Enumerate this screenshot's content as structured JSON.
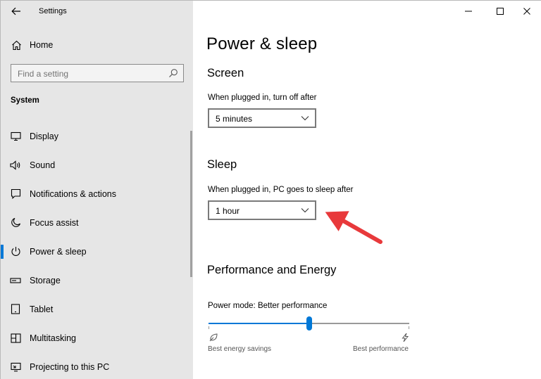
{
  "app": {
    "title": "Settings"
  },
  "sidebar": {
    "home_label": "Home",
    "search_placeholder": "Find a setting",
    "section_label": "System",
    "items": [
      {
        "label": "Display",
        "icon": "monitor-icon"
      },
      {
        "label": "Sound",
        "icon": "speaker-icon"
      },
      {
        "label": "Notifications & actions",
        "icon": "notification-icon"
      },
      {
        "label": "Focus assist",
        "icon": "moon-icon"
      },
      {
        "label": "Power & sleep",
        "icon": "power-icon",
        "selected": true
      },
      {
        "label": "Storage",
        "icon": "storage-icon"
      },
      {
        "label": "Tablet",
        "icon": "tablet-icon"
      },
      {
        "label": "Multitasking",
        "icon": "multitasking-icon"
      },
      {
        "label": "Projecting to this PC",
        "icon": "projector-icon"
      }
    ]
  },
  "main": {
    "title": "Power & sleep",
    "screen": {
      "heading": "Screen",
      "label": "When plugged in, turn off after",
      "value": "5 minutes"
    },
    "sleep": {
      "heading": "Sleep",
      "label": "When plugged in, PC goes to sleep after",
      "value": "1 hour"
    },
    "performance": {
      "heading": "Performance and Energy",
      "label": "Power mode: Better performance",
      "slider_level": 0.5,
      "min_label": "Best energy savings",
      "max_label": "Best performance"
    }
  },
  "colors": {
    "accent": "#0078d7",
    "sidebar_bg": "#e6e6e6",
    "arrow": "#e8393b"
  }
}
